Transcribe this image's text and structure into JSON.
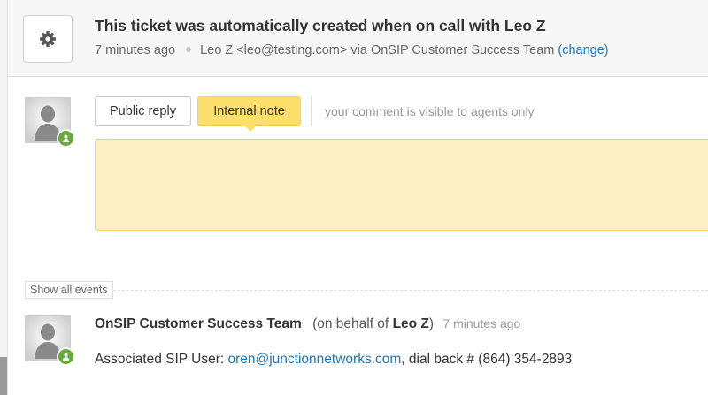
{
  "ticket": {
    "title": "This ticket was automatically created when on call with Leo Z",
    "time_ago": "7 minutes ago",
    "requester": "Leo Z <leo@testing.com>",
    "via": "via OnSIP Customer Success Team",
    "change_link": "(change)"
  },
  "composer": {
    "public_reply_label": "Public reply",
    "internal_note_label": "Internal note",
    "visibility_note": "your comment is visible to agents only"
  },
  "events": {
    "show_all_label": "Show all events",
    "items": [
      {
        "author": "OnSIP Customer Success Team",
        "behalf_prefix": "(on behalf of",
        "behalf_name": "Leo Z",
        "behalf_suffix": ")",
        "time_ago": "7 minutes ago",
        "body_prefix": "Associated SIP User:",
        "body_link": "oren@junctionnetworks.com",
        "body_suffix": ", dial back # (864) 354-2893"
      }
    ]
  },
  "colors": {
    "internal_note_bg": "#fcde6a",
    "comment_box_bg": "#fdf0c4",
    "link": "#1f73b7",
    "online_status": "#67a83f"
  },
  "icons": {
    "settings": "gear-icon",
    "avatar": "user-avatar-icon",
    "status": "online-status-icon"
  }
}
